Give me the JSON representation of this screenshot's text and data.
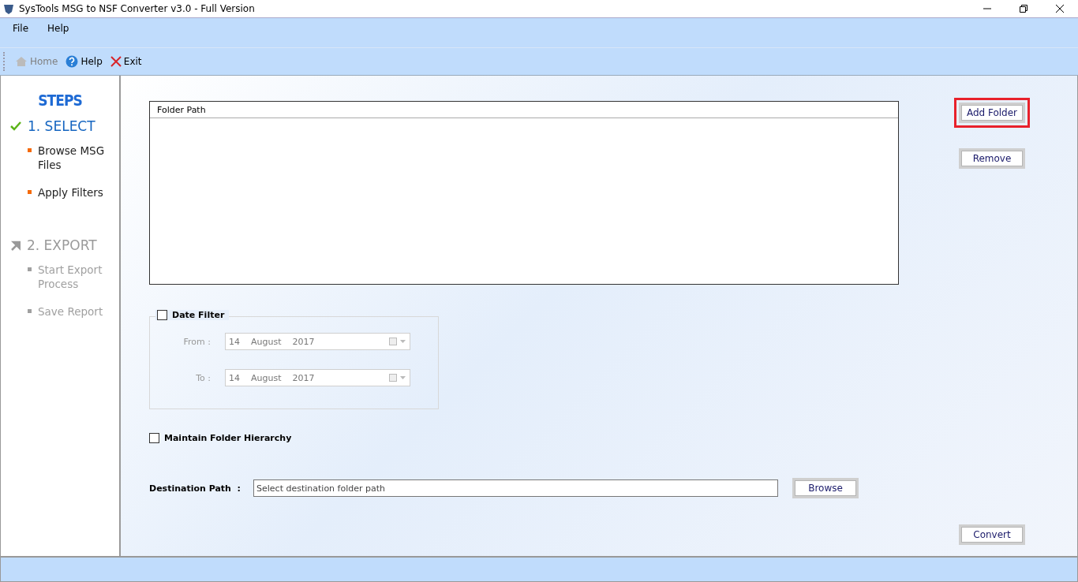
{
  "window": {
    "title": "SysTools MSG to NSF Converter v3.0 - Full Version"
  },
  "menu": [
    "File",
    "Help"
  ],
  "toolbar": [
    {
      "kind": "home",
      "label": "Home",
      "disabled": true
    },
    {
      "kind": "help",
      "label": "Help",
      "disabled": false
    },
    {
      "kind": "exit",
      "label": "Exit",
      "disabled": false
    }
  ],
  "sidebar": {
    "title": "STEPS",
    "steps": [
      {
        "label": "1. SELECT",
        "active": true,
        "items": [
          "Browse MSG Files",
          "Apply Filters"
        ]
      },
      {
        "label": "2. EXPORT",
        "active": false,
        "items": [
          "Start Export Process",
          "Save Report"
        ]
      }
    ]
  },
  "folder_table": {
    "columns": [
      "Folder Path"
    ]
  },
  "side_buttons": [
    {
      "label": "Add Folder",
      "highlighted": true
    },
    {
      "label": "Remove",
      "highlighted": false
    }
  ],
  "date_filter": {
    "label": "Date Filter",
    "checked": false,
    "rows": [
      {
        "label": "From :",
        "day": "14",
        "month": "August",
        "year": "2017"
      },
      {
        "label": "To :",
        "day": "14",
        "month": "August",
        "year": "2017"
      }
    ]
  },
  "hierarchy": {
    "label": "Maintain Folder Hierarchy",
    "checked": false
  },
  "destination": {
    "label": "Destination Path  :",
    "placeholder": "Select destination folder path",
    "button": "Browse"
  },
  "convert_button": "Convert"
}
